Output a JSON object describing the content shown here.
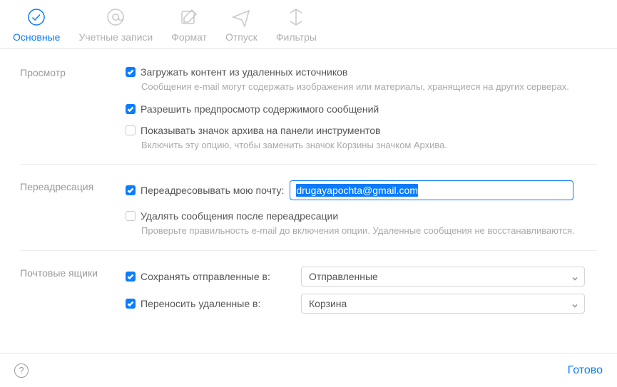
{
  "toolbar": {
    "items": [
      {
        "label": "Основные",
        "icon": "check-circle-icon",
        "active": true
      },
      {
        "label": "Учетные записи",
        "icon": "at-sign-icon",
        "active": false
      },
      {
        "label": "Формат",
        "icon": "compose-icon",
        "active": false
      },
      {
        "label": "Отпуск",
        "icon": "airplane-icon",
        "active": false
      },
      {
        "label": "Фильтры",
        "icon": "filters-icon",
        "active": false
      }
    ]
  },
  "sections": {
    "viewing": {
      "title": "Просмотр",
      "load_remote": {
        "label": "Загружать контент из удаленных источников",
        "checked": true,
        "hint": "Сообщения e-mail могут содержать изображения или материалы, хранящиеся на других серверах."
      },
      "allow_preview": {
        "label": "Разрешить предпросмотр содержимого сообщений",
        "checked": true
      },
      "show_archive": {
        "label": "Показывать значок архива на панели инструментов",
        "checked": false,
        "hint": "Включить эту опцию, чтобы заменить значок Корзины значком Архива."
      }
    },
    "forwarding": {
      "title": "Переадресация",
      "forward_my_mail": {
        "label": "Переадресовывать мою почту:",
        "checked": true,
        "value": "drugayapochta@gmail.com"
      },
      "delete_after": {
        "label": "Удалять сообщения после переадресации",
        "checked": false,
        "hint": "Проверьте правильность e-mail до включения опции. Удаленные сообщения не восстанавливаются."
      }
    },
    "mailboxes": {
      "title": "Почтовые ящики",
      "save_sent": {
        "label": "Сохранять отправленные в:",
        "checked": true,
        "value": "Отправленные"
      },
      "move_deleted": {
        "label": "Переносить удаленные в:",
        "checked": true,
        "value": "Корзина"
      }
    }
  },
  "footer": {
    "help_glyph": "?",
    "done_label": "Готово"
  }
}
